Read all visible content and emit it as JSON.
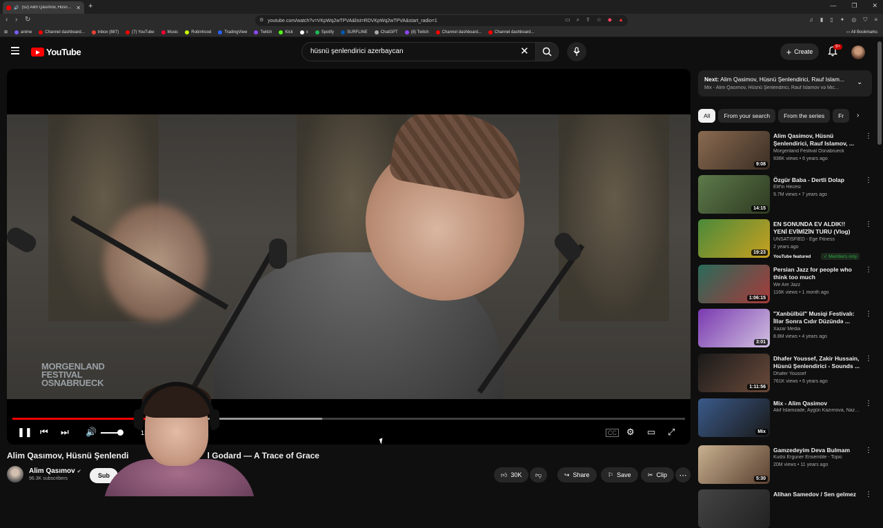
{
  "browser": {
    "tab_title": "(52) Alim Qasımov, Hüsnü Şe",
    "url": "youtube.com/watch?v=VKpWq2wTPVA&list=RDVKpWq2wTPVA&start_radio=1",
    "bookmarks": [
      "anime",
      "Channel dashboard...",
      "Inbox (887)",
      "(7) YouTube",
      "Music",
      "Robinhood",
      "TradingView",
      "Twitch",
      "Kick",
      "x",
      "Spotify",
      "SURFLINE",
      "ChatGPT",
      "(8) Twitch",
      "Channel dashboard...",
      "Channel dashboard..."
    ],
    "all_bookmarks": "All Bookmarks"
  },
  "header": {
    "logo_text": "YouTube",
    "search_value": "hüsnü şenlendirici azerbaycan",
    "create_label": "Create",
    "notif_count": "9+"
  },
  "player": {
    "watermark_lines": [
      "MORGENLAND",
      "FESTIVAL",
      "OSNABRUECK"
    ],
    "time": "1:56 / 6",
    "progress_fraction": 0.21,
    "buffer_fraction": 0.46
  },
  "video": {
    "title_left": "Alim Qasımov, Hüsnü Şenlendi",
    "title_right": "l Godard — A Trace of Grace",
    "channel": "Alim Qasımov",
    "subscribers": "96.3K subscribers",
    "subscribe_label": "Sub",
    "likes": "30K",
    "share_label": "Share",
    "save_label": "Save",
    "clip_label": "Clip"
  },
  "sidebar": {
    "next_prefix": "Next:",
    "next_title": "Alim Qasimov, Hüsnü Şenlendirici, Rauf Islam...",
    "next_sub": "Mix - Alim Qasımov, Hüsnü Şenlendirici, Rauf Islamov və Mic...",
    "chips": [
      "All",
      "From your search",
      "From the series",
      "Fr"
    ],
    "recommendations": [
      {
        "title": "Alim Qasimov, Hüsnü Şenlendirici, Rauf Islamov, ...",
        "channel": "Morgenland Festival Osnabrueck",
        "meta": "936K views • 6 years ago",
        "duration": "9:08"
      },
      {
        "title": "Özgür Baba - Dertli Dolap",
        "channel": "Elif'in Hecesi",
        "meta": "9.7M views • 7 years ago",
        "duration": "14:15"
      },
      {
        "title": "EN SONUNDA EV ALDIK!! YENİ EVİMİZİN TURU (Vlog)",
        "channel": "UNSATISFIED - Ege Fitness",
        "meta": "2 years ago",
        "duration": "19:23",
        "featured": "YouTube featured",
        "members": "Members only"
      },
      {
        "title": "Persian Jazz for people who think too much",
        "channel": "We Are Jazz",
        "meta": "116K views • 1 month ago",
        "duration": "1:06:15"
      },
      {
        "title": "\"Xanbülbül\" Musiqi Festivalı: İllər Sonra Cıdır Düzündə ...",
        "channel": "Xazar Media",
        "meta": "8.8M views • 4 years ago",
        "duration": "3:01"
      },
      {
        "title": "Dhafer Youssef, Zakir Hussain, Hüsnü Şenlendirici - Sounds ...",
        "channel": "Dhafer Youssef",
        "meta": "761K views • 6 years ago",
        "duration": "1:11:56"
      },
      {
        "title": "Mix - Alim Qasimov",
        "channel": "Akif Islamzade, Aygün Kazımova, Nazak...",
        "meta": "",
        "duration": "Mix"
      },
      {
        "title": "Gamzedeyim Deva Bulmam",
        "channel": "Kudsi Erguner Ensemble - Topic",
        "meta": "20M views • 11 years ago",
        "duration": "5:30"
      },
      {
        "title": "Alihan Samedov / Sen gelmez",
        "channel": "",
        "meta": "",
        "duration": ""
      }
    ]
  },
  "colors": {
    "accent": "#ff0000",
    "background": "#0f0f0f",
    "chip_bg": "#272727"
  }
}
